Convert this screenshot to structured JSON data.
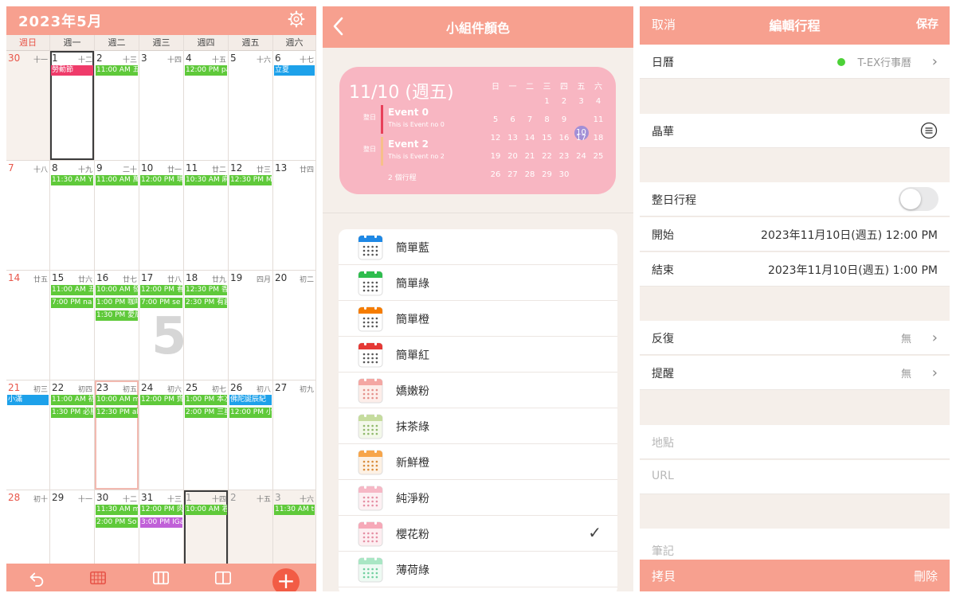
{
  "calendar": {
    "title": "2023年5月",
    "weekdays": [
      "週日",
      "週一",
      "週二",
      "週三",
      "週四",
      "週五",
      "週六"
    ],
    "big_week_number": "5",
    "weeks": [
      [
        {
          "d": "30",
          "l": "十一",
          "shade": true
        },
        {
          "d": "1",
          "l": "十二",
          "outlined": true,
          "ev": [
            {
              "t": "勞動節",
              "c": "#ef3b6a"
            }
          ]
        },
        {
          "d": "2",
          "l": "十三",
          "ev": [
            {
              "t": "11:00 AM 五",
              "c": "#5fc93a"
            }
          ]
        },
        {
          "d": "3",
          "l": "十四"
        },
        {
          "d": "4",
          "l": "十五",
          "ev": [
            {
              "t": "12:00 PM pa",
              "c": "#5fc93a"
            }
          ]
        },
        {
          "d": "5",
          "l": "十六"
        },
        {
          "d": "6",
          "l": "十七",
          "ev": [
            {
              "t": "立夏",
              "c": "#1da1ea"
            }
          ]
        }
      ],
      [
        {
          "d": "7",
          "l": "十八"
        },
        {
          "d": "8",
          "l": "十九",
          "ev": [
            {
              "t": "11:30 AM Y",
              "c": "#5fc93a"
            }
          ]
        },
        {
          "d": "9",
          "l": "二十",
          "ev": [
            {
              "t": "11:00 AM 萬",
              "c": "#5fc93a"
            }
          ]
        },
        {
          "d": "10",
          "l": "廿一",
          "ev": [
            {
              "t": "12:00 PM 瑪",
              "c": "#5fc93a"
            }
          ]
        },
        {
          "d": "11",
          "l": "廿二",
          "ev": [
            {
              "t": "10:30 AM 麻",
              "c": "#5fc93a"
            }
          ]
        },
        {
          "d": "12",
          "l": "廿三",
          "ev": [
            {
              "t": "12:30 PM M",
              "c": "#5fc93a"
            }
          ]
        },
        {
          "d": "13",
          "l": "廿四"
        }
      ],
      [
        {
          "d": "14",
          "l": "廿五"
        },
        {
          "d": "15",
          "l": "廿六",
          "ev": [
            {
              "t": "11:00 AM 五",
              "c": "#5fc93a"
            },
            {
              "t": "7:00 PM na",
              "c": "#5fc93a"
            }
          ]
        },
        {
          "d": "16",
          "l": "廿七",
          "ev": [
            {
              "t": "10:00 AM 發",
              "c": "#5fc93a"
            },
            {
              "t": "1:00 PM 咖啡",
              "c": "#5fc93a"
            },
            {
              "t": "1:30 PM 愛局",
              "c": "#5fc93a"
            }
          ]
        },
        {
          "d": "17",
          "l": "廿八",
          "ev": [
            {
              "t": "12:00 PM 看",
              "c": "#5fc93a"
            },
            {
              "t": "7:00 PM se",
              "c": "#5fc93a"
            }
          ]
        },
        {
          "d": "18",
          "l": "廿九",
          "ev": [
            {
              "t": "12:30 PM 香",
              "c": "#5fc93a"
            },
            {
              "t": "2:30 PM 有創",
              "c": "#5fc93a"
            }
          ]
        },
        {
          "d": "19",
          "l": "四月"
        },
        {
          "d": "20",
          "l": "初二"
        }
      ],
      [
        {
          "d": "21",
          "l": "初三",
          "ev": [
            {
              "t": "小滿",
              "c": "#1da1ea"
            }
          ]
        },
        {
          "d": "22",
          "l": "初四",
          "ev": [
            {
              "t": "11:00 AM 初",
              "c": "#5fc93a"
            },
            {
              "t": "1:30 PM 必勝",
              "c": "#5fc93a"
            }
          ]
        },
        {
          "d": "23",
          "l": "初五",
          "today": true,
          "ev": [
            {
              "t": "10:00 AM m",
              "c": "#5fc93a"
            },
            {
              "t": "12:30 PM al",
              "c": "#5fc93a"
            }
          ]
        },
        {
          "d": "24",
          "l": "初六",
          "ev": [
            {
              "t": "12:00 PM 齊",
              "c": "#5fc93a"
            }
          ]
        },
        {
          "d": "25",
          "l": "初七",
          "ev": [
            {
              "t": "1:00 PM 本次",
              "c": "#5fc93a"
            },
            {
              "t": "2:00 PM 三星",
              "c": "#5fc93a"
            }
          ]
        },
        {
          "d": "26",
          "l": "初八",
          "ev": [
            {
              "t": "佛陀誕辰紀",
              "c": "#1da1ea"
            },
            {
              "t": "12:00 PM 小",
              "c": "#5fc93a"
            }
          ]
        },
        {
          "d": "27",
          "l": "初九"
        }
      ],
      [
        {
          "d": "28",
          "l": "初十"
        },
        {
          "d": "29",
          "l": "十一"
        },
        {
          "d": "30",
          "l": "十二",
          "ev": [
            {
              "t": "11:30 AM m",
              "c": "#5fc93a"
            },
            {
              "t": "2:00 PM So",
              "c": "#5fc93a"
            }
          ]
        },
        {
          "d": "31",
          "l": "十三",
          "ev": [
            {
              "t": "12:00 PM 肉",
              "c": "#5fc93a"
            },
            {
              "t": "3:00 PM IGa",
              "c": "#c060d8"
            }
          ]
        },
        {
          "d": "1",
          "l": "十四",
          "shade": true,
          "outlined": true,
          "faded": true,
          "ev": [
            {
              "t": "10:00 AM 君",
              "c": "#5fc93a"
            }
          ]
        },
        {
          "d": "2",
          "l": "十五",
          "shade": true,
          "faded": true
        },
        {
          "d": "3",
          "l": "十六",
          "shade": true,
          "faded": true,
          "ev": [
            {
              "t": "11:30 AM tr",
              "c": "#5fc93a"
            }
          ]
        }
      ]
    ]
  },
  "widget_color": {
    "nav_title": "小組件顏色",
    "preview": {
      "date": "11/10 (週五)",
      "events": [
        {
          "tag": "整日",
          "title": "Event 0",
          "desc": "This is Event no 0",
          "bar": "#e8405a"
        },
        {
          "tag": "整日",
          "title": "Event 2",
          "desc": "This is Event no 2",
          "bar": "#f7c08a"
        }
      ],
      "count": "2 個行程",
      "month_weekdays": [
        "日",
        "一",
        "二",
        "三",
        "四",
        "五",
        "六"
      ],
      "month_rows": [
        [
          "",
          "",
          "",
          "1",
          "2",
          "3",
          "4"
        ],
        [
          "5",
          "6",
          "7",
          "8",
          "9",
          "10",
          "11"
        ],
        [
          "12",
          "13",
          "14",
          "15",
          "16",
          "17",
          "18"
        ],
        [
          "19",
          "20",
          "21",
          "22",
          "23",
          "24",
          "25"
        ],
        [
          "26",
          "27",
          "28",
          "29",
          "30",
          "",
          ""
        ]
      ],
      "month_today": "10"
    },
    "options": [
      {
        "label": "簡單藍",
        "top": "#1e88e5",
        "dots": "#555555",
        "bg": "#ffffff"
      },
      {
        "label": "簡單綠",
        "top": "#2ebd4e",
        "dots": "#555555",
        "bg": "#ffffff"
      },
      {
        "label": "簡單橙",
        "top": "#f57c00",
        "dots": "#555555",
        "bg": "#ffffff"
      },
      {
        "label": "簡單紅",
        "top": "#e53935",
        "dots": "#555555",
        "bg": "#ffffff"
      },
      {
        "label": "嬌嫩粉",
        "top": "#f4a7a3",
        "dots": "#e4908a",
        "bg": "#fdeeea"
      },
      {
        "label": "抹茶綠",
        "top": "#c5dc9e",
        "dots": "#8fb86a",
        "bg": "#f3f8ea"
      },
      {
        "label": "新鮮橙",
        "top": "#f7a54a",
        "dots": "#d98b3a",
        "bg": "#fdf1e4"
      },
      {
        "label": "純淨粉",
        "top": "#f6b8c6",
        "dots": "#e58ea3",
        "bg": "#fdf0f3"
      },
      {
        "label": "櫻花粉",
        "top": "#f6a9b8",
        "dots": "#e58ea3",
        "bg": "#fdeef1",
        "selected": true
      },
      {
        "label": "薄荷綠",
        "top": "#a9e6c4",
        "dots": "#6fcf9e",
        "bg": "#eefaf3"
      }
    ],
    "check_mark": "✓"
  },
  "edit_event": {
    "cancel": "取消",
    "title": "編輯行程",
    "save": "保存",
    "calendar_label": "日曆",
    "calendar_value": "T-EX行事曆",
    "calendar_dot_color": "#4cd137",
    "event_title": "晶華",
    "all_day_label": "整日行程",
    "start_label": "開始",
    "start_value": "2023年11月10日(週五) 12:00 PM",
    "end_label": "結束",
    "end_value": "2023年11月10日(週五) 1:00 PM",
    "repeat_label": "反復",
    "repeat_value": "無",
    "reminder_label": "提醒",
    "reminder_value": "無",
    "location_placeholder": "地點",
    "url_placeholder": "URL",
    "notes_placeholder": "筆記",
    "copy": "拷貝",
    "delete": "刪除"
  },
  "colors": {
    "accent": "#f7a08f",
    "event_green": "#5fc93a",
    "holiday_blue": "#1da1ea",
    "fab_red": "#f25c45",
    "widget_pink": "#f8b6c2"
  }
}
